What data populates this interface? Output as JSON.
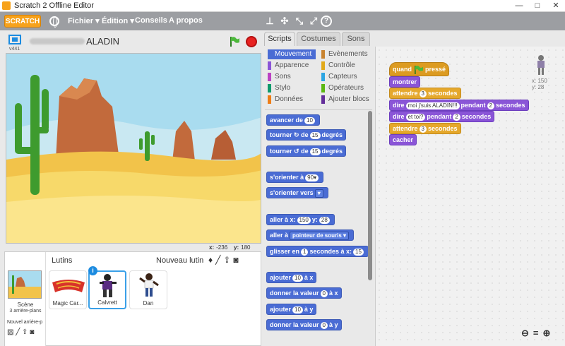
{
  "window": {
    "title": "Scratch 2 Offline Editor",
    "minimize": "—",
    "maximize": "□",
    "close": "✕"
  },
  "menubar": {
    "logo": "SCRATCH",
    "items": [
      "Fichier ▾",
      "Édition ▾",
      "Conseils",
      "A propos"
    ]
  },
  "stage_header": {
    "version": "v441",
    "project_name": "ALADIN"
  },
  "stage": {
    "x_label": "x:",
    "x_value": "-236",
    "y_label": "y:",
    "y_value": "180"
  },
  "sprites_panel": {
    "title": "Lutins",
    "new_sprite": "Nouveau lutin",
    "scene_label": "Scène",
    "scene_sub": "3 arrière-plans",
    "new_backdrop": "Nouvel arrière-p",
    "sprites": [
      {
        "name": "Magic Car..."
      },
      {
        "name": "Calvrett",
        "selected": true
      },
      {
        "name": "Dan"
      }
    ]
  },
  "tabs": [
    "Scripts",
    "Costumes",
    "Sons"
  ],
  "categories": {
    "left": [
      {
        "label": "Mouvement",
        "color": "#4a6cd4",
        "active": true
      },
      {
        "label": "Apparence",
        "color": "#8a55d7"
      },
      {
        "label": "Sons",
        "color": "#bb42c3"
      },
      {
        "label": "Stylo",
        "color": "#0e9a6c"
      },
      {
        "label": "Données",
        "color": "#ee7d16"
      }
    ],
    "right": [
      {
        "label": "Evènements",
        "color": "#c88330"
      },
      {
        "label": "Contrôle",
        "color": "#e1a91a"
      },
      {
        "label": "Capteurs",
        "color": "#2ca5e2"
      },
      {
        "label": "Opérateurs",
        "color": "#5cb712"
      },
      {
        "label": "Ajouter blocs",
        "color": "#632d99"
      }
    ]
  },
  "palette": {
    "move": [
      "avancer de",
      "10"
    ],
    "turn_right": [
      "tourner",
      "de",
      "15",
      "degrés"
    ],
    "turn_left": [
      "tourner",
      "de",
      "15",
      "degrés"
    ],
    "point_dir": [
      "s'orienter à",
      "90▾"
    ],
    "point_towards": [
      "s'orienter vers",
      "▾"
    ],
    "goto_xy": [
      "aller à x:",
      "150",
      "y:",
      "28"
    ],
    "goto": [
      "aller à",
      "pointeur de souris ▾"
    ],
    "glide": [
      "glisser en",
      "1",
      "secondes à x:",
      "15"
    ],
    "change_x": [
      "ajouter",
      "10",
      "à x"
    ],
    "set_x": [
      "donner la valeur",
      "0",
      "à x"
    ],
    "change_y": [
      "ajouter",
      "10",
      "à y"
    ],
    "set_y": [
      "donner la valeur",
      "0",
      "à y"
    ]
  },
  "script": {
    "sprite_x": "x: 150",
    "sprite_y": "y: 28",
    "when_flag": [
      "quand",
      "pressé"
    ],
    "show": "montrer",
    "wait1": [
      "attendre",
      "3",
      "secondes"
    ],
    "say1": [
      "dire",
      "moi j'suis ALADIN!!!",
      "pendant",
      "2",
      "secondes"
    ],
    "say2": [
      "dire",
      "et toi?",
      "pendant",
      "2",
      "secondes"
    ],
    "wait2": [
      "attendre",
      "3",
      "secondes"
    ],
    "hide": "cacher"
  },
  "zoom": [
    "⊖",
    "=",
    "⊕"
  ]
}
